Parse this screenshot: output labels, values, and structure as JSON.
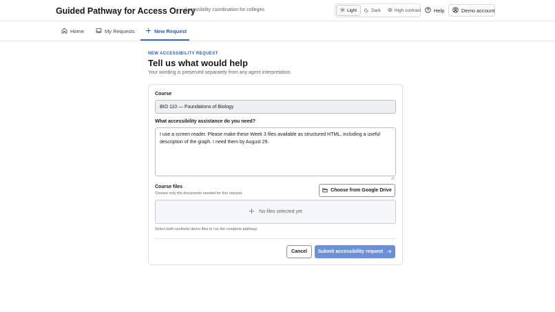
{
  "app": {
    "title": "Guided Pathway for Access Orrery",
    "tagline": "Accessibility coordination for colleges"
  },
  "header": {
    "theme_options": [
      {
        "label": "Light",
        "icon": "sun-icon",
        "selected": true
      },
      {
        "label": "Dark",
        "icon": "moon-icon",
        "selected": false
      },
      {
        "label": "High contrast",
        "icon": "eye-icon",
        "selected": false
      }
    ],
    "help_label": "Help",
    "account_label": "Demo account"
  },
  "nav": {
    "tabs": [
      {
        "label": "Home",
        "icon": "home-icon",
        "active": false
      },
      {
        "label": "My Requests",
        "icon": "inbox-icon",
        "active": false
      },
      {
        "label": "New Request",
        "icon": "plus-icon",
        "active": true
      }
    ]
  },
  "page": {
    "eyebrow": "NEW ACCESSIBILITY REQUEST",
    "title": "Tell us what would help",
    "subtitle": "Your wording is preserved separately from any agent interpretation."
  },
  "form": {
    "course_label": "Course",
    "course_value": "BIO 110 — Foundations of Biology",
    "assistance_label": "What accessibility assistance do you need?",
    "assistance_value": "I use a screen reader. Please make these Week 3 files available as structured HTML, including a useful description of the graph. I need them by August 29.",
    "files_label": "Course files",
    "files_hint": "Choose only the documents needed for this request.",
    "drive_button_label": "Choose from Google Drive",
    "dropzone_text": "No files selected yet",
    "demo_hint": "Select both synthetic demo files to run the complete pathway.",
    "cancel_label": "Cancel",
    "submit_label": "Submit accessibility request",
    "submit_enabled": false
  },
  "colors": {
    "accent": "#3867c8",
    "submit_disabled": "#6d8fd6"
  }
}
